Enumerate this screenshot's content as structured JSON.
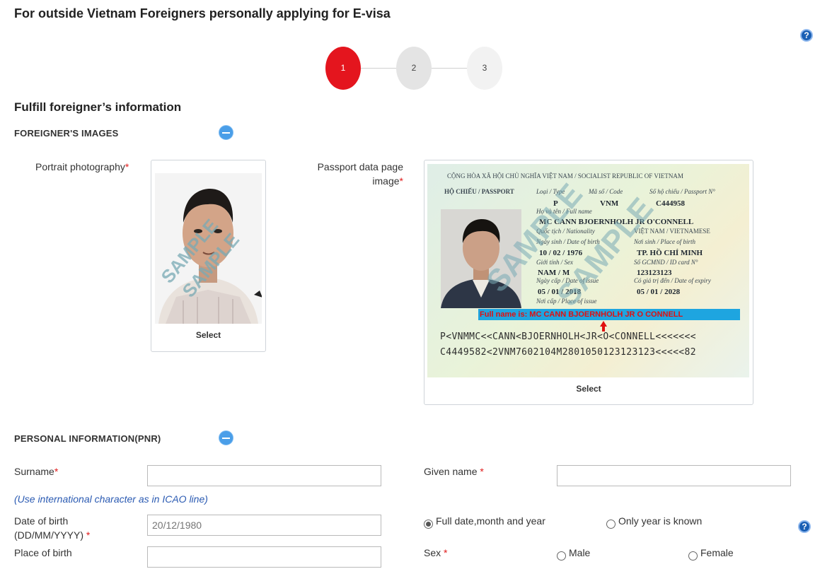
{
  "page": {
    "title": "For outside Vietnam Foreigners personally applying for E-visa"
  },
  "icons": {
    "help": "question-icon",
    "collapse": "minus-circle-icon"
  },
  "colors": {
    "accent": "#e4151e",
    "link": "#2a5ab2",
    "required": "#e01b1b",
    "collapse": "#4a9ee8"
  },
  "steps": [
    {
      "label": "1",
      "state": "active"
    },
    {
      "label": "2",
      "state": "inactive"
    },
    {
      "label": "3",
      "state": "inactive"
    }
  ],
  "help_glyph": "?",
  "form": {
    "heading": "Fulfill foreigner’s information",
    "images_section": {
      "title": "FOREIGNER'S IMAGES",
      "portrait": {
        "label": "Portrait photography",
        "required_mark": "*",
        "select_label": "Select",
        "watermark": "SAMPLE"
      },
      "passport": {
        "label_line1": "Passport data page",
        "label_line2": "image",
        "required_mark": "*",
        "select_label": "Select",
        "watermark": "SAMPLE",
        "doc": {
          "header": "CỘNG HÒA XÃ HỘI CHỦ NGHĨA VIỆT NAM / SOCIALIST REPUBLIC OF VIETNAM",
          "passport_label": "HỘ CHIẾU / PASSPORT",
          "type_label": "Loại / Type",
          "code_label": "Mã số / Code",
          "passport_no_label": "Số hộ chiếu / Passport N°",
          "type_value": "P",
          "code_value": "VNM",
          "passport_no": "C444958",
          "fullname_label": "Họ và tên / Full name",
          "fullname": "MC CANN BJOERNHOLH JR O'CONNELL",
          "nationality_label": "Quốc tịch / Nationality",
          "nationality": "VIỆT NAM / VIETNAMESE",
          "dob_label": "Ngày sinh / Date of birth",
          "dob": "10 / 02 / 1976",
          "pob_label": "Nơi sinh / Place of birth",
          "pob": "TP. HỒ CHÍ MINH",
          "sex_label": "Giới tính / Sex",
          "id_label": "Số GCMND / ID card N°",
          "sex": "NAM / M",
          "id_no": "123123123",
          "issue_label": "Ngày cấp / Date of issue",
          "expiry_label": "Có giá trị đến / Date of expiry",
          "issue": "05 / 01 / 2018",
          "expiry": "05 / 01 / 2028",
          "place_issue_label": "Nơi cấp / Place of issue",
          "fullname_hint": "Full name is: MC CANN BJOERNHOLH JR O CONNELL",
          "mrz1": "P<VNMMC<<CANN<BJOERNHOLH<JR<O<CONNELL<<<<<<<",
          "mrz2": "C4449582<2VNM7602104M2801050123123123<<<<<82"
        }
      }
    },
    "personal_section": {
      "title": "PERSONAL INFORMATION(PNR)",
      "surname_label": "Surname",
      "surname_value": "",
      "given_name_label": "Given name ",
      "given_name_value": "",
      "required_mark": "*",
      "hint": "(Use international character as in ICAO line)",
      "dob_label_line1": "Date of birth",
      "dob_label_line2": "(DD/MM/YYYY) ",
      "dob_placeholder": "20/12/1980",
      "dob_option_full": "Full date,month and year",
      "dob_option_year": "Only year is known",
      "place_of_birth_label": "Place of birth",
      "place_of_birth_value": "",
      "sex_label": "Sex ",
      "sex_male": "Male",
      "sex_female": "Female"
    }
  }
}
